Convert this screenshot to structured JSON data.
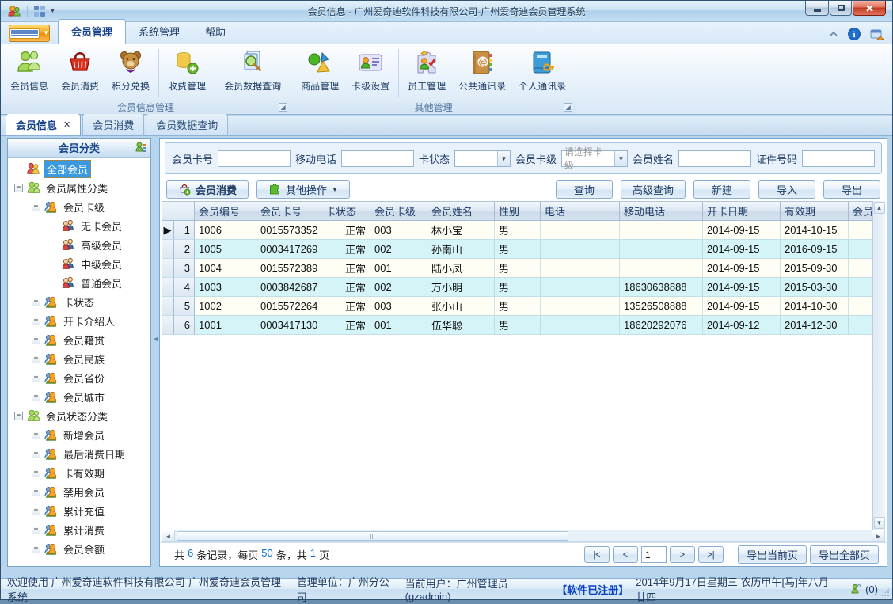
{
  "window": {
    "title": "会员信息 - 广州爱奇迪软件科技有限公司-广州爱奇迪会员管理系统"
  },
  "ribbon": {
    "tabs": [
      {
        "label": "会员管理",
        "active": true
      },
      {
        "label": "系统管理",
        "active": false
      },
      {
        "label": "帮助",
        "active": false
      }
    ],
    "groups": [
      {
        "label": "会员信息管理",
        "buttons": [
          {
            "label": "会员信息",
            "icon": "members"
          },
          {
            "label": "会员消费",
            "icon": "basket"
          },
          {
            "label": "积分兑换",
            "icon": "teddy"
          },
          {
            "label": "收费管理",
            "icon": "coins",
            "sep": true
          },
          {
            "label": "会员数据查询",
            "icon": "docsearch",
            "sep": true
          }
        ]
      },
      {
        "label": "其他管理",
        "buttons": [
          {
            "label": "商品管理",
            "icon": "shapes"
          },
          {
            "label": "卡级设置",
            "icon": "card"
          },
          {
            "label": "员工管理",
            "icon": "staff",
            "sep": true
          },
          {
            "label": "公共通讯录",
            "icon": "addressbook"
          },
          {
            "label": "个人通讯录",
            "icon": "bookkey"
          }
        ]
      }
    ]
  },
  "doc_tabs": [
    {
      "label": "会员信息",
      "active": true,
      "closable": true
    },
    {
      "label": "会员消费",
      "active": false
    },
    {
      "label": "会员数据查询",
      "active": false
    }
  ],
  "sidebar": {
    "title": "会员分类",
    "tree": [
      {
        "label": "全部会员",
        "level": 0,
        "toggle": "none",
        "icon": "members-all",
        "selected": true
      },
      {
        "label": "会员属性分类",
        "level": 0,
        "toggle": "minus",
        "icon": "people-green"
      },
      {
        "label": "会员卡级",
        "level": 1,
        "toggle": "minus",
        "icon": "pair-orange"
      },
      {
        "label": "无卡会员",
        "level": 2,
        "toggle": "none",
        "icon": "pair-red"
      },
      {
        "label": "高级会员",
        "level": 2,
        "toggle": "none",
        "icon": "pair-red"
      },
      {
        "label": "中级会员",
        "level": 2,
        "toggle": "none",
        "icon": "pair-red"
      },
      {
        "label": "普通会员",
        "level": 2,
        "toggle": "none",
        "icon": "pair-red"
      },
      {
        "label": "卡状态",
        "level": 1,
        "toggle": "plus",
        "icon": "pair-orange"
      },
      {
        "label": "开卡介绍人",
        "level": 1,
        "toggle": "plus",
        "icon": "pair-orange"
      },
      {
        "label": "会员籍贯",
        "level": 1,
        "toggle": "plus",
        "icon": "pair-orange"
      },
      {
        "label": "会员民族",
        "level": 1,
        "toggle": "plus",
        "icon": "pair-orange"
      },
      {
        "label": "会员省份",
        "level": 1,
        "toggle": "plus",
        "icon": "pair-orange"
      },
      {
        "label": "会员城市",
        "level": 1,
        "toggle": "plus",
        "icon": "pair-orange"
      },
      {
        "label": "会员状态分类",
        "level": 0,
        "toggle": "minus",
        "icon": "people-green"
      },
      {
        "label": "新增会员",
        "level": 1,
        "toggle": "plus",
        "icon": "pair-orange"
      },
      {
        "label": "最后消费日期",
        "level": 1,
        "toggle": "plus",
        "icon": "pair-orange"
      },
      {
        "label": "卡有效期",
        "level": 1,
        "toggle": "plus",
        "icon": "pair-orange"
      },
      {
        "label": "禁用会员",
        "level": 1,
        "toggle": "plus",
        "icon": "pair-orange"
      },
      {
        "label": "累计充值",
        "level": 1,
        "toggle": "plus",
        "icon": "pair-orange"
      },
      {
        "label": "累计消费",
        "level": 1,
        "toggle": "plus",
        "icon": "pair-orange"
      },
      {
        "label": "会员余额",
        "level": 1,
        "toggle": "plus",
        "icon": "pair-orange"
      }
    ]
  },
  "filters": [
    {
      "label": "会员卡号",
      "type": "input",
      "value": ""
    },
    {
      "label": "移动电话",
      "type": "input",
      "value": ""
    },
    {
      "label": "卡状态",
      "type": "select",
      "value": "",
      "width": 76
    },
    {
      "label": "会员卡级",
      "type": "select",
      "value": "请选择卡级",
      "placeholder": true,
      "width": 90
    },
    {
      "label": "会员姓名",
      "type": "input",
      "value": ""
    },
    {
      "label": "证件号码",
      "type": "input",
      "value": ""
    }
  ],
  "toolbar": {
    "left": [
      {
        "label": "会员消费",
        "icon": "basket-add",
        "bold": true
      },
      {
        "label": "其他操作",
        "icon": "puzzle",
        "dropdown": true
      }
    ],
    "right": [
      "查询",
      "高级查询",
      "新建",
      "导入",
      "导出"
    ]
  },
  "table": {
    "columns": [
      "会员编号",
      "会员卡号",
      "卡状态",
      "会员卡级",
      "会员姓名",
      "性别",
      "电话",
      "移动电话",
      "开卡日期",
      "有效期",
      "会员"
    ],
    "rows": [
      {
        "num": 1,
        "active": true,
        "cells": [
          "1006",
          "0015573352",
          "正常",
          "003",
          "林小宝",
          "男",
          "",
          "",
          "2014-09-15",
          "2014-10-15",
          ""
        ]
      },
      {
        "num": 2,
        "active": false,
        "cells": [
          "1005",
          "0003417269",
          "正常",
          "002",
          "孙南山",
          "男",
          "",
          "",
          "2014-09-15",
          "2016-09-15",
          ""
        ]
      },
      {
        "num": 3,
        "active": false,
        "cells": [
          "1004",
          "0015572389",
          "正常",
          "001",
          "陆小凤",
          "男",
          "",
          "",
          "2014-09-15",
          "2015-09-30",
          ""
        ]
      },
      {
        "num": 4,
        "active": false,
        "cells": [
          "1003",
          "0003842687",
          "正常",
          "002",
          "万小明",
          "男",
          "",
          "18630638888",
          "2014-09-15",
          "2015-03-30",
          ""
        ]
      },
      {
        "num": 5,
        "active": false,
        "cells": [
          "1002",
          "0015572264",
          "正常",
          "003",
          "张小山",
          "男",
          "",
          "13526508888",
          "2014-09-15",
          "2014-10-30",
          ""
        ]
      },
      {
        "num": 6,
        "active": false,
        "cells": [
          "1001",
          "0003417130",
          "正常",
          "001",
          "伍华聪",
          "男",
          "",
          "18620292076",
          "2014-09-12",
          "2014-12-30",
          ""
        ]
      }
    ]
  },
  "pagination": {
    "record_info": {
      "p1": "共",
      "n1": "6",
      "p2": "条记录，每页",
      "n2": "50",
      "p3": "条，共",
      "n3": "1",
      "p4": "页"
    },
    "first": "|<",
    "prev": "<",
    "page": "1",
    "next": ">",
    "last": ">|",
    "export_current": "导出当前页",
    "export_all": "导出全部页"
  },
  "statusbar": {
    "welcome": "欢迎使用 广州爱奇迪软件科技有限公司-广州爱奇迪会员管理系统",
    "unit": "管理单位：广州分公司",
    "user": "当前用户：广州管理员(gzadmin)",
    "registered": "【软件已注册】",
    "date": "2014年9月17日星期三 农历甲午[马]年八月廿四",
    "online_count": "(0)"
  },
  "colors": {
    "selection": "#3b99e0",
    "row_cream": "#fffef4",
    "row_cyan": "#d5f4f8",
    "link_blue": "#0a42c4",
    "number_blue": "#0a6cd6"
  }
}
